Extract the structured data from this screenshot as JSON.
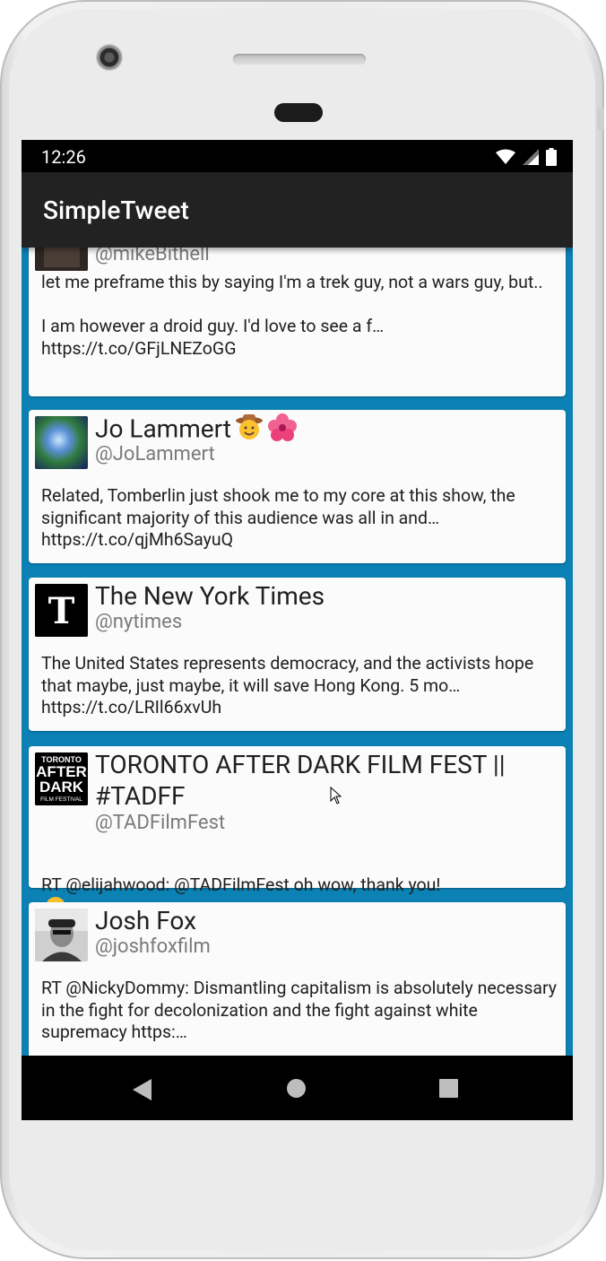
{
  "status_bar": {
    "time": "12:26"
  },
  "app_bar": {
    "title": "SimpleTweet"
  },
  "tweets": [
    {
      "name": "",
      "handle": "@mikeBithell",
      "body": "let me preframe this by saying I'm a trek guy, not a wars guy, but..\n\nI am however a droid guy. I'd love to see a f…\nhttps://t.co/GFjLNEZoGG"
    },
    {
      "name": "Jo Lammert",
      "handle": "@JoLammert",
      "emoji": [
        "cowboy-face-emoji",
        "hibiscus-emoji"
      ],
      "body": "Related, Tomberlin just shook me to my core at this show, the significant majority of this audience was all in and…\nhttps://t.co/qjMh6SayuQ"
    },
    {
      "name": "The New York Times",
      "handle": "@nytimes",
      "avatar_letter": "T",
      "body": "The United States represents democracy, and the activists hope that maybe, just maybe, it will save Hong Kong. 5 mo…\nhttps://t.co/LRIl66xvUh"
    },
    {
      "name": "TORONTO AFTER DARK FILM FEST || #TADFF",
      "handle": "@TADFilmFest",
      "avatar_lines": [
        "TORONTO",
        "AFTER",
        "DARK",
        "FILM FESTIVAL"
      ],
      "body": "RT @elijahwood: @TADFilmFest oh wow, thank you!",
      "emoji": [
        "smiling-face-emoji"
      ]
    },
    {
      "name": "Josh Fox",
      "handle": "@joshfoxfilm",
      "body": "RT @NickyDommy: Dismantling capitalism is absolutely necessary in the fight for decolonization and the fight against white supremacy https:…"
    }
  ],
  "colors": {
    "feed_background": "#0b81b4",
    "app_bar": "#222222",
    "card": "#fbfbfb",
    "handle_text": "#7a7a7a"
  }
}
